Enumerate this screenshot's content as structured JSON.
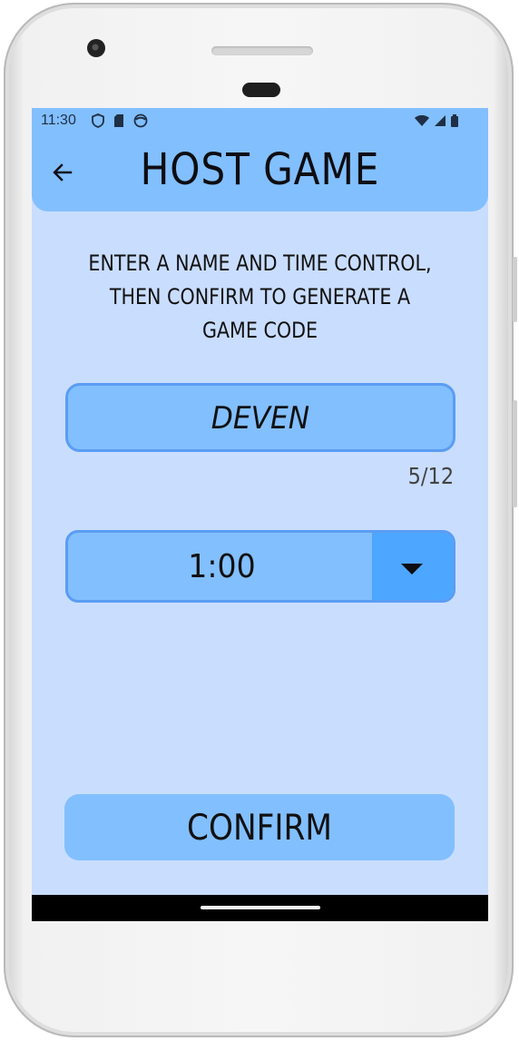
{
  "status_bar": {
    "time": "11:30",
    "left_icons": [
      "shield-icon",
      "sd-card-icon",
      "face-icon"
    ],
    "right_icons": [
      "wifi-icon",
      "signal-icon",
      "battery-icon"
    ]
  },
  "app_bar": {
    "title": "HOST GAME",
    "back_icon": "arrow-left-icon"
  },
  "instructions": "ENTER A NAME AND TIME CONTROL, THEN CONFIRM TO GENERATE A GAME CODE",
  "name_field": {
    "value": "DEVEN",
    "counter": "5/12"
  },
  "time_control": {
    "selected": "1:00",
    "dropdown_icon": "caret-down-icon"
  },
  "confirm_button": {
    "label": "CONFIRM"
  },
  "colors": {
    "screen_background": "#c9ddff",
    "app_bar": "#82bffe",
    "input_fill": "#82bffe",
    "input_border": "#5b9df4",
    "dropdown_button": "#4da6ff"
  }
}
